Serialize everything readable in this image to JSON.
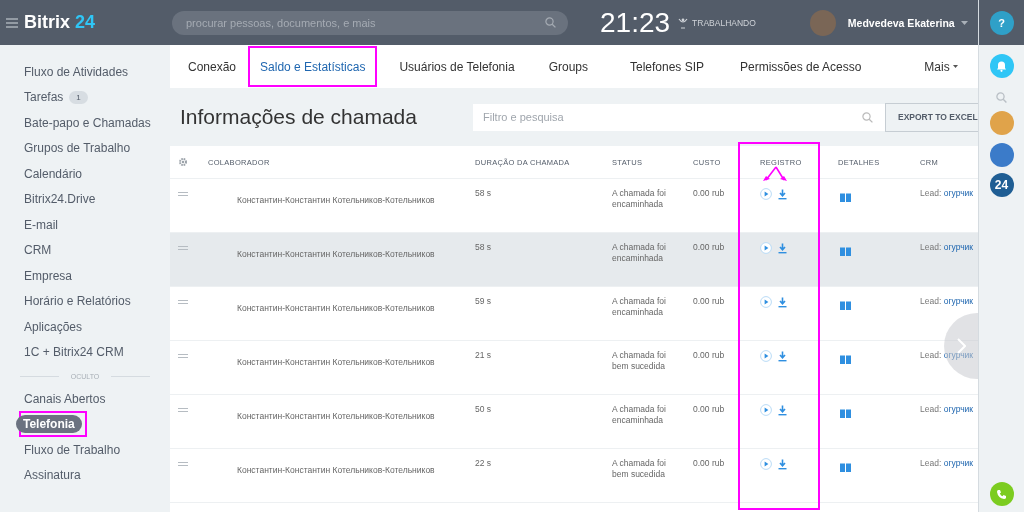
{
  "header": {
    "logo_text": "Bitrix",
    "logo_number": "24",
    "search": {
      "placeholder": "procurar pessoas, documentos, e mais"
    },
    "clock": "21:23",
    "work_status": "TRABALHANDO",
    "user_name": "Medvedeva Ekaterina"
  },
  "sidebar": {
    "items": [
      {
        "label": "Fluxo de Atividades",
        "selected": false,
        "highlighted": false
      },
      {
        "label": "Tarefas",
        "badge": "1",
        "selected": false,
        "highlighted": false
      },
      {
        "label": "Bate-papo e Chamadas",
        "selected": false,
        "highlighted": false
      },
      {
        "label": "Grupos de Trabalho",
        "selected": false,
        "highlighted": false
      },
      {
        "label": "Calendário",
        "selected": false,
        "highlighted": false
      },
      {
        "label": "Bitrix24.Drive",
        "selected": false,
        "highlighted": false
      },
      {
        "label": "E-mail",
        "selected": false,
        "highlighted": false
      },
      {
        "label": "CRM",
        "selected": false,
        "highlighted": false
      },
      {
        "label": "Empresa",
        "selected": false,
        "highlighted": false
      },
      {
        "label": "Horário e Relatórios",
        "selected": false,
        "highlighted": false
      },
      {
        "label": "Aplicações",
        "selected": false,
        "highlighted": false
      },
      {
        "label": "1C + Bitrix24 CRM",
        "selected": false,
        "highlighted": false
      }
    ],
    "hidden_section": "OCULTO",
    "hidden_items": [
      {
        "label": "Canais Abertos",
        "selected": false,
        "highlighted": false
      },
      {
        "label": "Telefonia",
        "selected": true,
        "highlighted": true
      },
      {
        "label": "Fluxo de Trabalho",
        "selected": false,
        "highlighted": false
      },
      {
        "label": "Assinatura",
        "selected": false,
        "highlighted": false
      }
    ]
  },
  "tabs": [
    {
      "label": "Conexão",
      "selected": false,
      "highlighted": false
    },
    {
      "label": "Saldo e Estatísticas",
      "selected": true,
      "highlighted": true
    },
    {
      "label": "Usuários de Telefonia",
      "selected": false,
      "highlighted": false
    },
    {
      "label": "Groups",
      "selected": false,
      "highlighted": false
    },
    {
      "label": "Telefones SIP",
      "selected": false,
      "highlighted": false
    },
    {
      "label": "Permissões de Acesso",
      "selected": false,
      "highlighted": false
    }
  ],
  "more_tab": "Mais",
  "page_title": "Informações de chamada",
  "filter": {
    "placeholder": "Filtro e pesquisa"
  },
  "export_button": "EXPORT TO EXCEL",
  "table": {
    "columns": [
      {
        "label": "COLABORADOR",
        "highlighted": false
      },
      {
        "label": "DURAÇÃO DA CHAMADA",
        "highlighted": false
      },
      {
        "label": "STATUS",
        "highlighted": false
      },
      {
        "label": "CUSTO",
        "highlighted": false
      },
      {
        "label": "REGISTRO",
        "highlighted": true
      },
      {
        "label": "DETALHES",
        "highlighted": false
      },
      {
        "label": "CRM",
        "highlighted": false
      }
    ],
    "rows": [
      {
        "employee": "Константин-Константин Котельников-Котельников",
        "duration": "58 s",
        "status": "A chamada foi encaminhada",
        "cost": "0.00 rub",
        "crm_label": "Lead:",
        "crm_link": "огурчик",
        "hovered": false
      },
      {
        "employee": "Константин-Константин Котельников-Котельников",
        "duration": "58 s",
        "status": "A chamada foi encaminhada",
        "cost": "0.00 rub",
        "crm_label": "Lead:",
        "crm_link": "огурчик",
        "hovered": true
      },
      {
        "employee": "Константин-Константин Котельников-Котельников",
        "duration": "59 s",
        "status": "A chamada foi encaminhada",
        "cost": "0.00 rub",
        "crm_label": "Lead:",
        "crm_link": "огурчик",
        "hovered": false
      },
      {
        "employee": "Константин-Константин Котельников-Котельников",
        "duration": "21 s",
        "status": "A chamada foi bem sucedida",
        "cost": "0.00 rub",
        "crm_label": "Lead:",
        "crm_link": "огурчик",
        "hovered": false
      },
      {
        "employee": "Константин-Константин Котельников-Котельников",
        "duration": "50 s",
        "status": "A chamada foi encaminhada",
        "cost": "0.00 rub",
        "crm_label": "Lead:",
        "crm_link": "огурчик",
        "hovered": false
      },
      {
        "employee": "Константин-Константин Котельников-Котельников",
        "duration": "22 s",
        "status": "A chamada foi bem sucedida",
        "cost": "0.00 rub",
        "crm_label": "Lead:",
        "crm_link": "огурчик",
        "hovered": false
      }
    ]
  },
  "right_panel": {
    "help": "?",
    "app_badge": "24"
  }
}
